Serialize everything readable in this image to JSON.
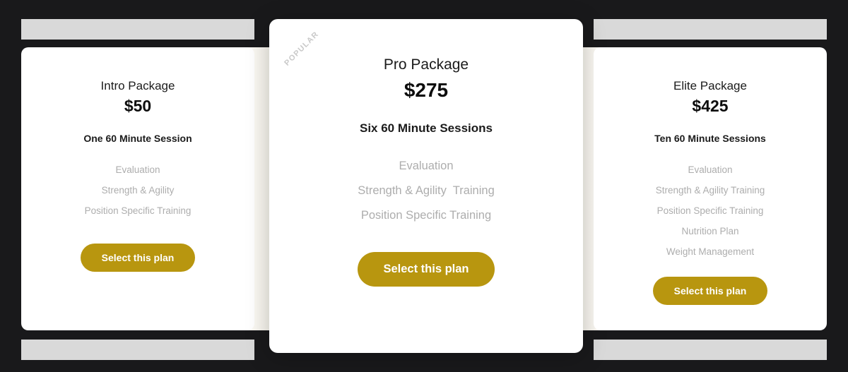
{
  "theme": {
    "frame_color": "#19191B",
    "card_background": "#FFFFFF",
    "accent_color": "#B8960F",
    "button_text_color": "#FFFFFF",
    "feature_text_color": "#ADADAD",
    "placeholder_bar_color": "#D9D9D9",
    "cream_panel_color": "#F4F1E8",
    "badge_text_color": "#C9C9C9"
  },
  "plans": [
    {
      "id": "intro",
      "name": "Intro Package",
      "price": "$50",
      "sessions": "One 60 Minute Session",
      "features": [
        "Evaluation",
        "Strength & Agility",
        "Position Specific Training"
      ],
      "cta_label": "Select this plan",
      "featured": false,
      "badge": ""
    },
    {
      "id": "pro",
      "name": "Pro Package",
      "price": "$275",
      "sessions": "Six 60 Minute Sessions",
      "features": [
        "Evaluation",
        "Strength & Agility  Training",
        "Position Specific Training"
      ],
      "cta_label": "Select this plan",
      "featured": true,
      "badge": "POPULAR"
    },
    {
      "id": "elite",
      "name": "Elite Package",
      "price": "$425",
      "sessions": "Ten 60 Minute Sessions",
      "features": [
        "Evaluation",
        "Strength & Agility Training",
        "Position Specific Training",
        "Nutrition Plan",
        "Weight Management"
      ],
      "cta_label": "Select this plan",
      "featured": false,
      "badge": ""
    }
  ]
}
